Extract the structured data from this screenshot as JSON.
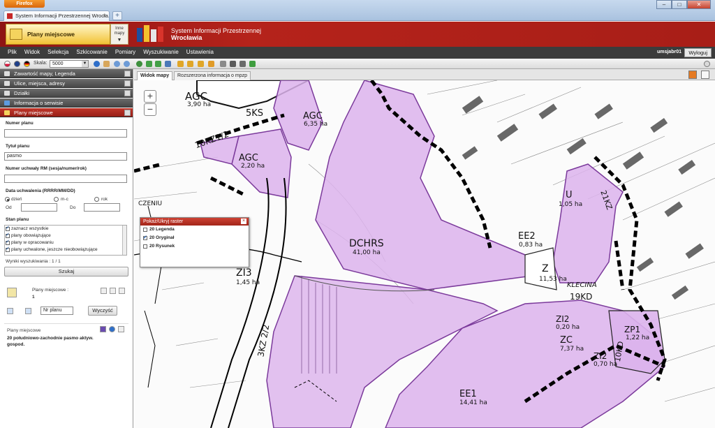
{
  "browser": {
    "menu_button": "Firefox",
    "tab_title": "System Informacji Przestrzennej Wrocła...",
    "new_tab": "+"
  },
  "header": {
    "module_title": "Plany miejscowe",
    "other_maps": "Inne mapy",
    "system_name": "System Informacji Przestrzennej",
    "city": "Wrocławia"
  },
  "menubar": {
    "items": [
      "Plik",
      "Widok",
      "Selekcja",
      "Szkicowanie",
      "Pomiary",
      "Wyszukiwanie",
      "Ustawienia"
    ],
    "user": "umsjabr01",
    "logout": "Wyloguj"
  },
  "toolbar": {
    "scale_label": "Skala:",
    "scale_value": "5000"
  },
  "sidebar": {
    "accordion": [
      "Zawartość mapy, Legenda",
      "Ulice, miejsca, adresy",
      "Działki",
      "Informacja o serwisie",
      "Plany miejscowe"
    ],
    "form": {
      "plan_number_label": "Numer planu",
      "plan_number_value": "",
      "plan_title_label": "Tytuł planu",
      "plan_title_value": "pasmo",
      "resolution_label": "Numer uchwały RM (sesja/numer/rok)",
      "resolution_value": "",
      "date_label": "Data uchwalenia (RRRR/MM/DD)",
      "radio_day": "dzień",
      "radio_month": "m-c",
      "radio_year": "rok",
      "from_label": "Od",
      "to_label": "Do",
      "status_label": "Stan planu",
      "status_items": [
        "zaznacz wszystkie",
        "plany obowiązujące",
        "plany w opracowaniu",
        "plany uchwalone, jeszcze nieobowiązujące"
      ]
    },
    "results_label": "Wyniki wyszukiwania : 1 / 1",
    "search_button": "Szukaj",
    "result": {
      "title": "Plany miejscowe :",
      "count": "1",
      "sort_value": "Nr planu",
      "clear_button": "Wyczyść"
    },
    "card": {
      "category": "Plany miejscowe",
      "description": "20 południowo-zachodnie pasmo aktyw. gospod."
    }
  },
  "map": {
    "tabs": [
      "Widok mapy",
      "Rozszerzona informacja o mpzp"
    ],
    "zoom_in": "+",
    "zoom_out": "−",
    "raster_panel": {
      "title": "Pokaż/Ukryj raster",
      "items": [
        "20 Legenda",
        "20 Oryginał",
        "20 Rysunek"
      ]
    },
    "labels": {
      "agc1": "AGC",
      "agc1_area": "3,90 ha",
      "sks": "5KS",
      "agc2": "AGC",
      "agc2_area": "6,35 ha",
      "agc3": "AGC",
      "agc3_area": "2,20 ha",
      "kzr": "10KZ1/2",
      "czeniu": "CZENIU",
      "dchrs": "DCHRS",
      "dchrs_area": "41,00 ha",
      "u": "U",
      "u_area": "1,05 ha",
      "zkz": "21KZ",
      "ee2": "EE2",
      "ee2_area": "0,83 ha",
      "z": "Z",
      "z_area": "11,53 ha",
      "klecina": "KLECINA",
      "kd": "19KD",
      "zi3": "ZI3",
      "zi3_area": "1,45 ha",
      "kz3": "3KZ 2/2",
      "zi2a": "ZI2",
      "zi2a_area": "0,20 ha",
      "zp1": "ZP1",
      "zp1_area": "1,22 ha",
      "zc": "ZC",
      "zc_area": "7,37 ha",
      "zi2b": "ZI2",
      "zi2b_area": "0,70 ha",
      "ee1": "EE1",
      "ee1_area": "14,41 ha",
      "kd2": "10KD"
    }
  },
  "colors": {
    "accent": "#a81e17",
    "zone_fill": "#dcb3ec",
    "zone_stroke": "#7b3a9b"
  }
}
